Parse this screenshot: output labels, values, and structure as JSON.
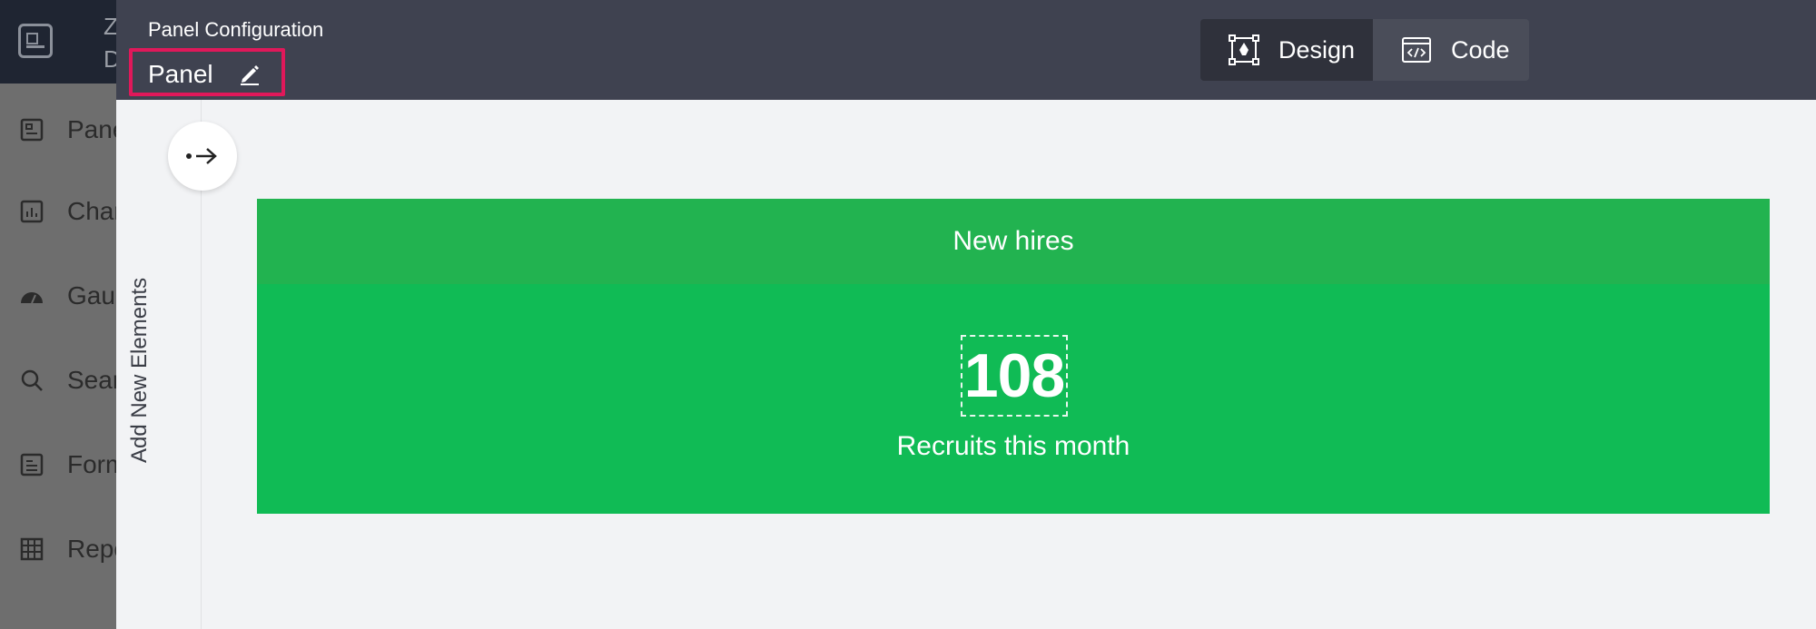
{
  "background_app": {
    "brand_line1": "Z",
    "brand_line2": "D",
    "nav_items": [
      {
        "label": "Pane",
        "icon": "panel-icon"
      },
      {
        "label": "Char",
        "icon": "chart-icon"
      },
      {
        "label": "Gaug",
        "icon": "gauge-icon"
      },
      {
        "label": "Sear",
        "icon": "search-icon"
      },
      {
        "label": "Form",
        "icon": "form-icon"
      },
      {
        "label": "Repo",
        "icon": "report-icon"
      }
    ]
  },
  "panel": {
    "config_label": "Panel Configuration",
    "name": "Panel",
    "modes": {
      "design_label": "Design",
      "code_label": "Code",
      "active": "design"
    },
    "rail": {
      "label": "Add New Elements"
    },
    "kpi": {
      "title": "New hires",
      "value": "108",
      "caption": "Recruits this month"
    }
  },
  "colors": {
    "header_bg": "#3f4250",
    "highlight_border": "#e0185a",
    "kpi_green": "#10bb55",
    "kpi_header_green": "#22b350"
  }
}
